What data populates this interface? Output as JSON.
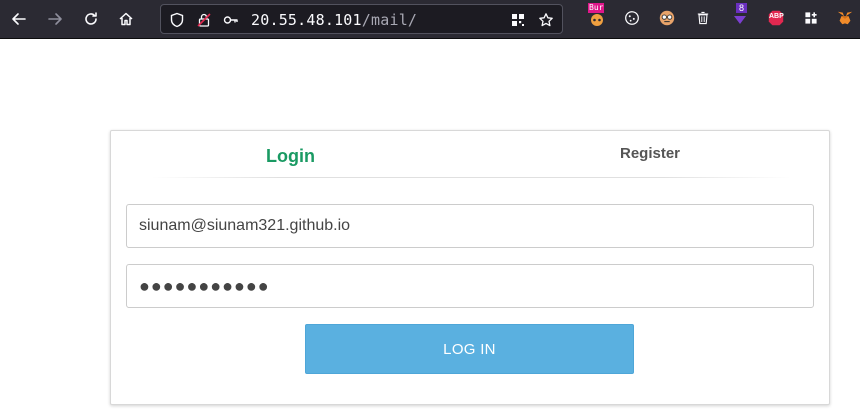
{
  "browser": {
    "url_host": "20.55.48.101",
    "url_path": "/mail/",
    "extensions": [
      {
        "name": "burp-extension",
        "badge": "Bur"
      },
      {
        "name": "cookie-extension",
        "badge": ""
      },
      {
        "name": "avatar-extension",
        "badge": ""
      },
      {
        "name": "trash-extension",
        "badge": ""
      },
      {
        "name": "download-extension",
        "badge": "8"
      },
      {
        "name": "adblock-extension",
        "badge": "ABP"
      },
      {
        "name": "extensions-menu",
        "badge": ""
      },
      {
        "name": "metamask-extension",
        "badge": ""
      }
    ]
  },
  "login": {
    "tab_login": "Login",
    "tab_register": "Register",
    "email_value": "siunam@siunam321.github.io",
    "password_masked": "●●●●●●●●●●●",
    "submit_label": "LOG IN"
  },
  "colors": {
    "active_tab": "#1a9a63",
    "button": "#5ab0e0",
    "toolbar": "#2b2a33"
  }
}
